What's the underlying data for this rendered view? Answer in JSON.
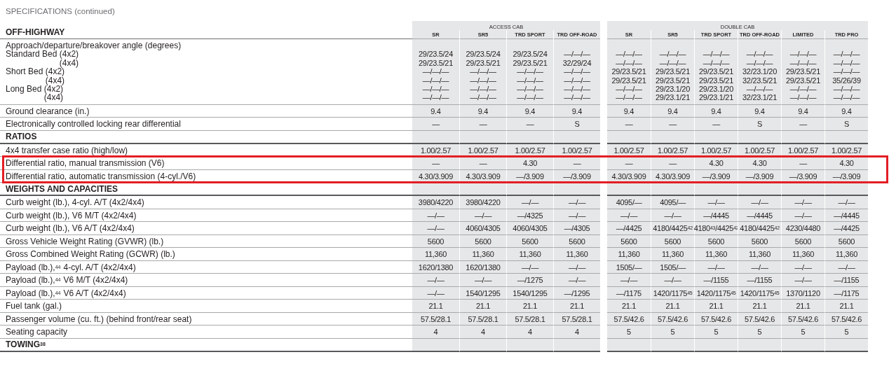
{
  "title": "SPECIFICATIONS (continued)",
  "groups": [
    {
      "label": "ACCESS CAB",
      "columns": [
        "SR",
        "SR5",
        "TRD SPORT",
        "TRD OFF-ROAD"
      ]
    },
    {
      "label": "DOUBLE CAB",
      "columns": [
        "SR",
        "SR5",
        "TRD SPORT",
        "TRD OFF-ROAD",
        "LIMITED",
        "TRD PRO"
      ]
    }
  ],
  "rows": [
    {
      "kind": "column_heading",
      "label": "OFF-HIGHWAY",
      "highlighted": false
    },
    {
      "kind": "multi",
      "label": "Approach/departure/breakover angle (degrees)",
      "highlighted": false,
      "beds": [
        {
          "bed": "Standard Bed",
          "lines": [
            {
              "drive": "(4x2)",
              "values": [
                "29/23.5/24",
                "29/23.5/24",
                "29/23.5/24",
                "—/—/—",
                "—/—/—",
                "—/—/—",
                "—/—/—",
                "—/—/—",
                "—/—/—",
                "—/—/—"
              ]
            },
            {
              "drive": "(4x4)",
              "values": [
                "29/23.5/21",
                "29/23.5/21",
                "29/23.5/21",
                "32/29/24",
                "—/—/—",
                "—/—/—",
                "—/—/—",
                "—/—/—",
                "—/—/—",
                "—/—/—"
              ]
            }
          ]
        },
        {
          "bed": "Short Bed",
          "lines": [
            {
              "drive": "(4x2)",
              "values": [
                "—/—/—",
                "—/—/—",
                "—/—/—",
                "—/—/—",
                "29/23.5/21",
                "29/23.5/21",
                "29/23.5/21",
                "32/23.1/20",
                "29/23.5/21",
                "—/—/—"
              ]
            },
            {
              "drive": "(4x4)",
              "values": [
                "—/—/—",
                "—/—/—",
                "—/—/—",
                "—/—/—",
                "29/23.5/21",
                "29/23.5/21",
                "29/23.5/21",
                "32/23.5/21",
                "29/23.5/21",
                "35/26/39"
              ]
            }
          ]
        },
        {
          "bed": "Long Bed",
          "lines": [
            {
              "drive": "(4x2)",
              "values": [
                "—/—/—",
                "—/—/—",
                "—/—/—",
                "—/—/—",
                "—/—/—",
                "29/23.1/20",
                "29/23.1/20",
                "—/—/—",
                "—/—/—",
                "—/—/—"
              ]
            },
            {
              "drive": "(4x4)",
              "values": [
                "—/—/—",
                "—/—/—",
                "—/—/—",
                "—/—/—",
                "—/—/—",
                "29/23.1/21",
                "29/23.1/21",
                "32/23.1/21",
                "—/—/—",
                "—/—/—"
              ]
            }
          ]
        }
      ]
    },
    {
      "kind": "row",
      "label": "Ground clearance (in.)",
      "highlighted": false,
      "values": [
        "9.4",
        "9.4",
        "9.4",
        "9.4",
        "9.4",
        "9.4",
        "9.4",
        "9.4",
        "9.4",
        "9.4"
      ]
    },
    {
      "kind": "row",
      "label": "Electronically controlled locking rear differential",
      "highlighted": false,
      "values": [
        "—",
        "—",
        "—",
        "S",
        "—",
        "—",
        "—",
        "S",
        "—",
        "S"
      ]
    },
    {
      "kind": "heading",
      "label": "RATIOS",
      "highlighted": false
    },
    {
      "kind": "row",
      "label": "4x4 transfer case ratio (high/low)",
      "highlighted": false,
      "values": [
        "1.00/2.57",
        "1.00/2.57",
        "1.00/2.57",
        "1.00/2.57",
        "1.00/2.57",
        "1.00/2.57",
        "1.00/2.57",
        "1.00/2.57",
        "1.00/2.57",
        "1.00/2.57"
      ]
    },
    {
      "kind": "row",
      "label": "Differential ratio, manual transmission (V6)",
      "highlighted": true,
      "values": [
        "—",
        "—",
        "4.30",
        "—",
        "—",
        "—",
        "4.30",
        "4.30",
        "—",
        "4.30"
      ]
    },
    {
      "kind": "row",
      "label": "Differential ratio, automatic transmission (4-cyl./V6)",
      "highlighted": true,
      "values": [
        "4.30/3.909",
        "4.30/3.909",
        "—/3.909",
        "—/3.909",
        "4.30/3.909",
        "4.30/3.909",
        "—/3.909",
        "—/3.909",
        "—/3.909",
        "—/3.909"
      ]
    },
    {
      "kind": "heading",
      "label": "WEIGHTS AND CAPACITIES",
      "highlighted": false
    },
    {
      "kind": "row",
      "label": "Curb weight (lb.), 4-cyl. A/T (4x2/4x4)",
      "highlighted": false,
      "values": [
        "3980/4220",
        "3980/4220",
        "—/—",
        "—/—",
        "4095/—",
        "4095/—",
        "—/—",
        "—/—",
        "—/—",
        "—/—"
      ]
    },
    {
      "kind": "row",
      "label": "Curb weight (lb.), V6 M/T (4x2/4x4)",
      "highlighted": false,
      "values": [
        "—/—",
        "—/—",
        "—/4325",
        "—/—",
        "—/—",
        "—/—",
        "—/4445",
        "—/4445",
        "—/—",
        "—/4445"
      ]
    },
    {
      "kind": "row",
      "label": "Curb weight (lb.), V6 A/T (4x2/4x4)",
      "highlighted": false,
      "values": [
        "—/—",
        "4060/4305",
        "4060/4305",
        "—/4305",
        "—/4425",
        "4180/4425$^{42}$",
        "4180$^{43}$/4425$^{42}$",
        "4180/4425$^{42}$",
        "4230/4480",
        "—/4425"
      ]
    },
    {
      "kind": "row",
      "label": "Gross Vehicle Weight Rating (GVWR) (lb.)",
      "highlighted": false,
      "values": [
        "5600",
        "5600",
        "5600",
        "5600",
        "5600",
        "5600",
        "5600",
        "5600",
        "5600",
        "5600"
      ]
    },
    {
      "kind": "row",
      "label": "Gross Combined Weight Rating (GCWR) (lb.)",
      "highlighted": false,
      "values": [
        "11,360",
        "11,360",
        "11,360",
        "11,360",
        "11,360",
        "11,360",
        "11,360",
        "11,360",
        "11,360",
        "11,360"
      ]
    },
    {
      "kind": "row",
      "label": "Payload (lb.),$^{44}$ 4-cyl. A/T (4x2/4x4)",
      "highlighted": false,
      "values": [
        "1620/1380",
        "1620/1380",
        "—/—",
        "—/—",
        "1505/—",
        "1505/—",
        "—/—",
        "—/—",
        "—/—",
        "—/—"
      ]
    },
    {
      "kind": "row",
      "label": "Payload (lb.),$^{44}$ V6 M/T (4x2/4x4)",
      "highlighted": false,
      "values": [
        "—/—",
        "—/—",
        "—/1275",
        "—/—",
        "—/—",
        "—/—",
        "—/1155",
        "—/1155",
        "—/—",
        "—/1155"
      ]
    },
    {
      "kind": "row",
      "label": "Payload (lb.),$^{44}$ V6 A/T (4x2/4x4)",
      "highlighted": false,
      "values": [
        "—/—",
        "1540/1295",
        "1540/1295",
        "—/1295",
        "—/1175",
        "1420/1175$^{45}$",
        "1420/1175$^{45}$",
        "1420/1175$^{45}$",
        "1370/1120",
        "—/1175"
      ]
    },
    {
      "kind": "row",
      "label": "Fuel tank (gal.)",
      "highlighted": false,
      "values": [
        "21.1",
        "21.1",
        "21.1",
        "21.1",
        "21.1",
        "21.1",
        "21.1",
        "21.1",
        "21.1",
        "21.1"
      ]
    },
    {
      "kind": "row",
      "label": "Passenger volume (cu. ft.) (behind front/rear seat)",
      "highlighted": false,
      "values": [
        "57.5/28.1",
        "57.5/28.1",
        "57.5/28.1",
        "57.5/28.1",
        "57.5/42.6",
        "57.5/42.6",
        "57.5/42.6",
        "57.5/42.6",
        "57.5/42.6",
        "57.5/42.6"
      ]
    },
    {
      "kind": "row",
      "label": "Seating capacity",
      "highlighted": false,
      "values": [
        "4",
        "4",
        "4",
        "4",
        "5",
        "5",
        "5",
        "5",
        "5",
        "5"
      ]
    },
    {
      "kind": "heading",
      "label": "TOWING$^{38}$",
      "highlighted": false
    }
  ]
}
